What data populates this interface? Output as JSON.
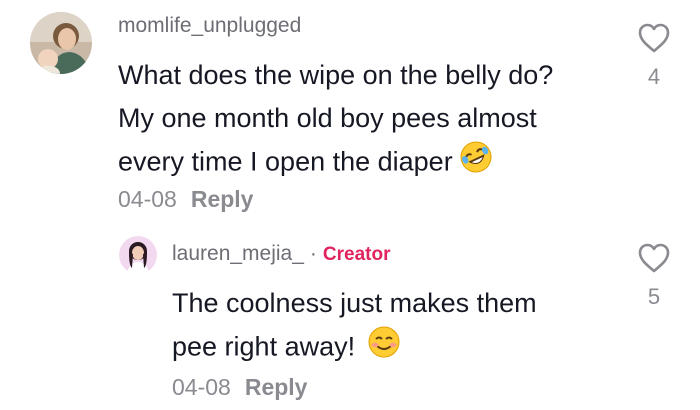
{
  "comments": [
    {
      "username": "momlife_unplugged",
      "text_lines": [
        "What does the wipe on the belly do?",
        "My one month old boy pees almost",
        "every time I open the diaper"
      ],
      "emoji": "rolling-on-floor-laughing",
      "date": "04-08",
      "reply_label": "Reply",
      "like_count": "4"
    }
  ],
  "replies": [
    {
      "username": "lauren_mejia_",
      "separator": "·",
      "badge": "Creator",
      "text_lines": [
        "The coolness just makes them",
        "pee right away!"
      ],
      "emoji": "smiling-face",
      "date": "04-08",
      "reply_label": "Reply",
      "like_count": "5"
    }
  ],
  "icons": {
    "like": "heart-outline-icon"
  },
  "colors": {
    "username": "#6d6e75",
    "text": "#161823",
    "meta": "#8a8b91",
    "creator_badge": "#e0245e"
  }
}
